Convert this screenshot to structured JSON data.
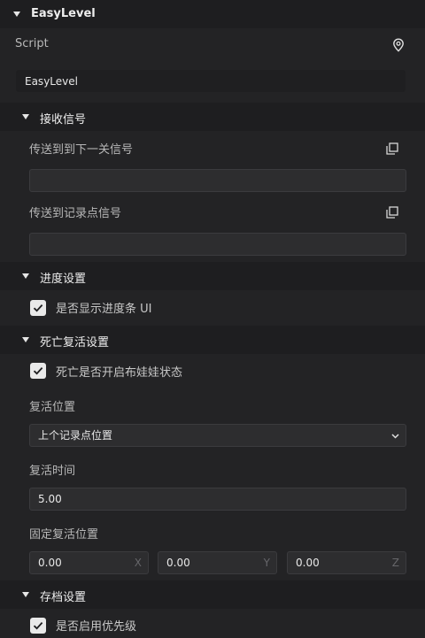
{
  "component": {
    "title": "EasyLevel",
    "script_label": "Script",
    "script_value": "EasyLevel",
    "location_icon": "location-pin-icon"
  },
  "sections": {
    "receive": {
      "title": "接收信号",
      "next_level_label": "传送到到下一关信号",
      "next_level_value": "",
      "checkpoint_label": "传送到记录点信号",
      "checkpoint_value": "",
      "copy_icon": "copy-icon"
    },
    "progress": {
      "title": "进度设置",
      "show_progress_label": "是否显示进度条 UI",
      "show_progress_checked": true
    },
    "death": {
      "title": "死亡复活设置",
      "ragdoll_label": "死亡是否开启布娃娃状态",
      "ragdoll_checked": true,
      "respawn_position_label": "复活位置",
      "respawn_position_value": "上个记录点位置",
      "respawn_time_label": "复活时间",
      "respawn_time_value": "5.00",
      "fixed_position_label": "固定复活位置",
      "fixed_x": "0.00",
      "fixed_y": "0.00",
      "fixed_z": "0.00",
      "axis_x": "X",
      "axis_y": "Y",
      "axis_z": "Z"
    },
    "save": {
      "title": "存档设置",
      "priority_label": "是否启用优先级",
      "priority_checked": true
    }
  },
  "colors": {
    "background": "#232325",
    "header": "#1e1e20",
    "field": "#2d2d2f",
    "checkbox": "#e9e9e9"
  }
}
